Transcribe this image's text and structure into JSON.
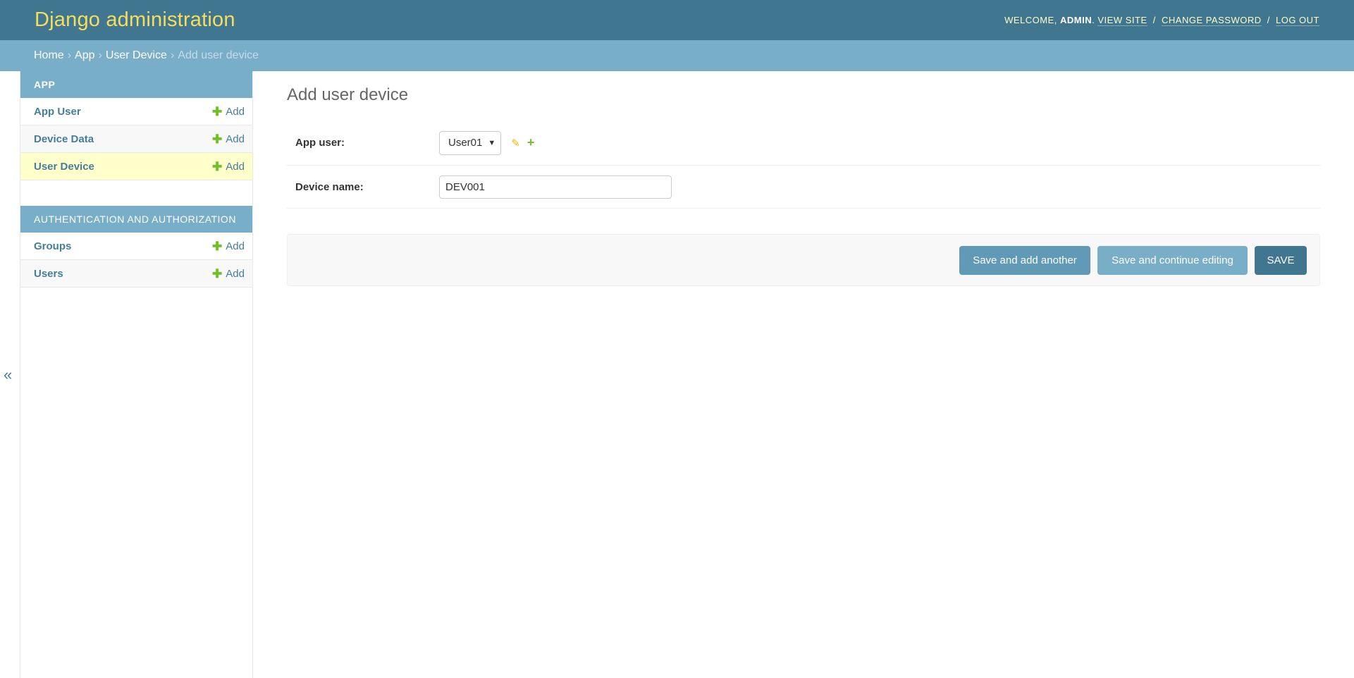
{
  "header": {
    "branding": "Django administration",
    "welcome": "Welcome,",
    "username": "admin",
    "view_site": "View site",
    "change_password": "Change password",
    "log_out": "Log out",
    "separator": "/"
  },
  "breadcrumbs": {
    "home": "Home",
    "app": "App",
    "model": "User Device",
    "current": "Add user device",
    "separator": "›"
  },
  "sidebar": {
    "toggle_glyph": "«",
    "modules": [
      {
        "caption": "App",
        "models": [
          {
            "name": "App User",
            "add": "Add"
          },
          {
            "name": "Device Data",
            "add": "Add"
          },
          {
            "name": "User Device",
            "add": "Add"
          }
        ]
      },
      {
        "caption": "Authentication and Authorization",
        "models": [
          {
            "name": "Groups",
            "add": "Add"
          },
          {
            "name": "Users",
            "add": "Add"
          }
        ]
      }
    ]
  },
  "content": {
    "title": "Add user device",
    "fields": {
      "app_user": {
        "label": "App user:",
        "value": "User01"
      },
      "device_name": {
        "label": "Device name:",
        "value": "DEV001"
      }
    },
    "buttons": {
      "save_add_another": "Save and add another",
      "save_continue": "Save and continue editing",
      "save": "Save"
    }
  },
  "colors": {
    "header_bg": "#417690",
    "branding": "#f5dd5d",
    "breadcrumbs_bg": "#79aec8",
    "link": "#447e9b",
    "add_green": "#70bf2b",
    "current_row": "#ffffcc"
  },
  "icons": {
    "add": "plus-icon",
    "change_related": "pencil-icon",
    "add_related": "plus-icon",
    "select_arrow": "chevron-down-icon",
    "collapse_sidebar": "double-chevron-left-icon"
  }
}
